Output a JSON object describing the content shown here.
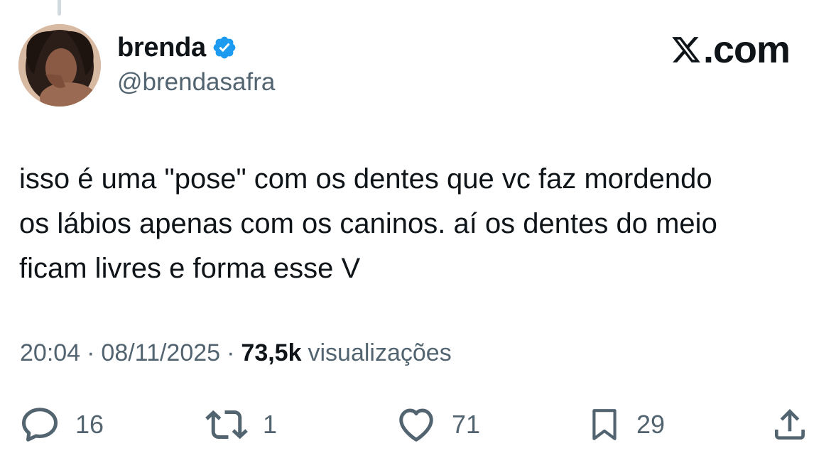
{
  "author": {
    "display_name": "brenda",
    "handle": "@brendasafra",
    "verified": true,
    "avatar_icon": "profile-photo"
  },
  "brand": {
    "text": ".com",
    "logo_icon": "x-logo-icon"
  },
  "tweet": {
    "text": "isso é uma \"pose\" com os dentes que vc faz mordendo\nos lábios apenas com os caninos. aí os dentes do meio\nficam livres e forma esse V",
    "time": "20:04",
    "date": "08/11/2025",
    "separator": "·",
    "views_count": "73,5k",
    "views_label": "visualizações"
  },
  "actions": {
    "replies": "16",
    "retweets": "1",
    "likes": "71",
    "bookmarks": "29"
  },
  "colors": {
    "text_primary": "#0f1419",
    "text_secondary": "#536471",
    "verified_blue": "#1d9bf0"
  }
}
